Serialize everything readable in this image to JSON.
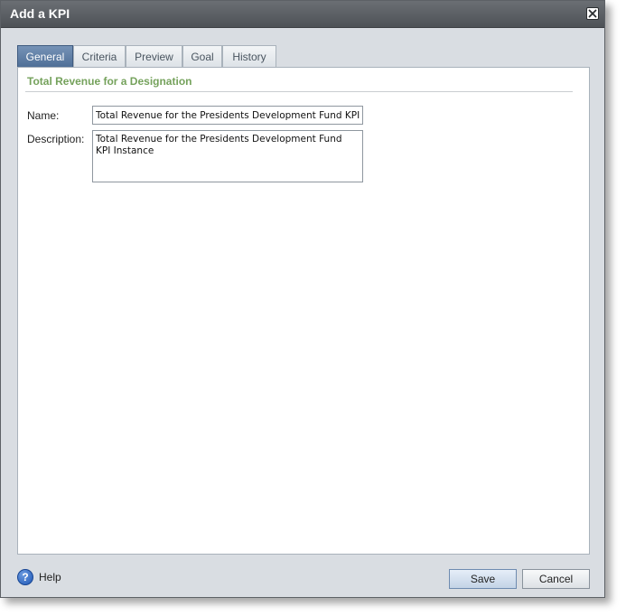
{
  "dialog": {
    "title": "Add a KPI"
  },
  "tabs": [
    {
      "label": "General"
    },
    {
      "label": "Criteria"
    },
    {
      "label": "Preview"
    },
    {
      "label": "Goal"
    },
    {
      "label": "History"
    }
  ],
  "general": {
    "section_title": "Total Revenue for a Designation",
    "name_label": "Name:",
    "name_value": "Total Revenue for the Presidents Development Fund KPI Instance",
    "description_label": "Description:",
    "description_value": "Total Revenue for the Presidents Development Fund KPI Instance"
  },
  "footer": {
    "help_label": "Help",
    "save_label": "Save",
    "cancel_label": "Cancel"
  },
  "colors": {
    "active_tab": "#5a7aa3",
    "section_title": "#75a25c",
    "titlebar": "#595d62"
  },
  "icons": {
    "close": "close-icon",
    "help": "help-icon"
  }
}
